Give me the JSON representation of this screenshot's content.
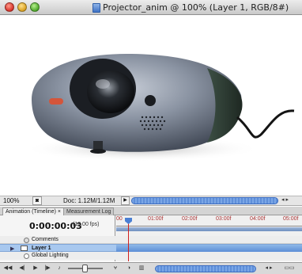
{
  "window": {
    "title": "Projector_anim @ 100% (Layer 1, RGB/8#)"
  },
  "statusbar": {
    "zoom": "100%",
    "doc_size": "Doc: 1.12M/1.12M"
  },
  "panel": {
    "tabs": [
      {
        "label": "Animation (Timeline) ×",
        "active": true
      },
      {
        "label": "Measurement Log",
        "active": false
      }
    ]
  },
  "timeline": {
    "current_time": "0:00:00:03",
    "fps": "(10.00 fps)",
    "ruler_labels": [
      "00",
      "01:00f",
      "02:00f",
      "03:00f",
      "04:00f",
      "05:00f"
    ],
    "rows": {
      "comments": "Comments",
      "layer": "Layer 1",
      "global_lighting": "Global Lighting"
    }
  },
  "colors": {
    "selection_blue": "#a8c8ef",
    "playhead_red": "#d02020",
    "scroll_blue": "#5f8fd9"
  },
  "icons": [
    "close-icon",
    "minimize-icon",
    "zoom-icon",
    "document-icon",
    "stopwatch-icon",
    "film-icon",
    "play-icon",
    "first-frame-icon",
    "previous-frame-icon",
    "next-frame-icon",
    "tween-icon",
    "trash-icon",
    "new-layer-icon"
  ]
}
